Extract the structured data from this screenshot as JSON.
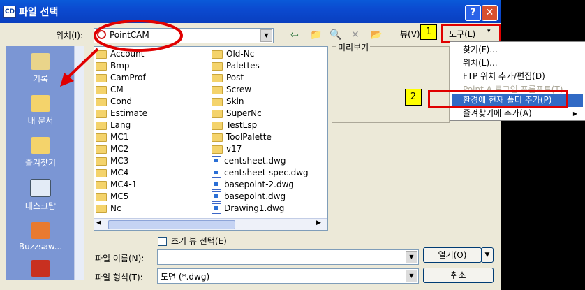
{
  "window": {
    "title": "파일 선택"
  },
  "location": {
    "label": "위치(I):",
    "value": "PointCAM"
  },
  "toolbar": {
    "view_label": "뷰(V)",
    "tools_label": "도구(L)"
  },
  "places": [
    {
      "label": "기록"
    },
    {
      "label": "내 문서"
    },
    {
      "label": "즐겨찾기"
    },
    {
      "label": "데스크탑"
    },
    {
      "label": "Buzzsaw..."
    }
  ],
  "files_col1": [
    "Account",
    "Bmp",
    "CamProf",
    "CM",
    "Cond",
    "Estimate",
    "Lang",
    "MC1",
    "MC2",
    "MC3",
    "MC4",
    "MC4-1",
    "MC5",
    "Nc"
  ],
  "files_col2_folders": [
    "Old-Nc",
    "Palettes",
    "Post",
    "Screw",
    "Skin",
    "SuperNc",
    "TestLsp",
    "ToolPalette",
    "v17"
  ],
  "files_col2_dwg": [
    "centsheet.dwg",
    "centsheet-spec.dwg",
    "basepoint-2.dwg",
    "basepoint.dwg",
    "Drawing1.dwg"
  ],
  "preview": {
    "label": "미리보기"
  },
  "menu": {
    "items": [
      {
        "label": "찾기(F)..."
      },
      {
        "label": "위치(L)..."
      },
      {
        "label": "FTP 위치 추가/편집(D)"
      },
      {
        "label": "Point A 로그인 프롬프트(T)"
      },
      {
        "label": "환경에 현재 폴더 추가(P)"
      },
      {
        "label": "즐겨찾기에 추가(A)"
      }
    ]
  },
  "checkbox": {
    "label": "초기 뷰 선택(E)"
  },
  "filename": {
    "label": "파일 이름(N):",
    "value": ""
  },
  "filetype": {
    "label": "파일 형식(T):",
    "value": "도면 (*.dwg)"
  },
  "buttons": {
    "open": "열기(O)",
    "cancel": "취소"
  },
  "annotations": {
    "step1": "1",
    "step2": "2"
  },
  "colors": {
    "title_bar": "#0b4ad0",
    "places_bg": "#7b96d4",
    "highlight": "#316ac5",
    "annotation": "#e00000",
    "callout": "#ffff00"
  }
}
